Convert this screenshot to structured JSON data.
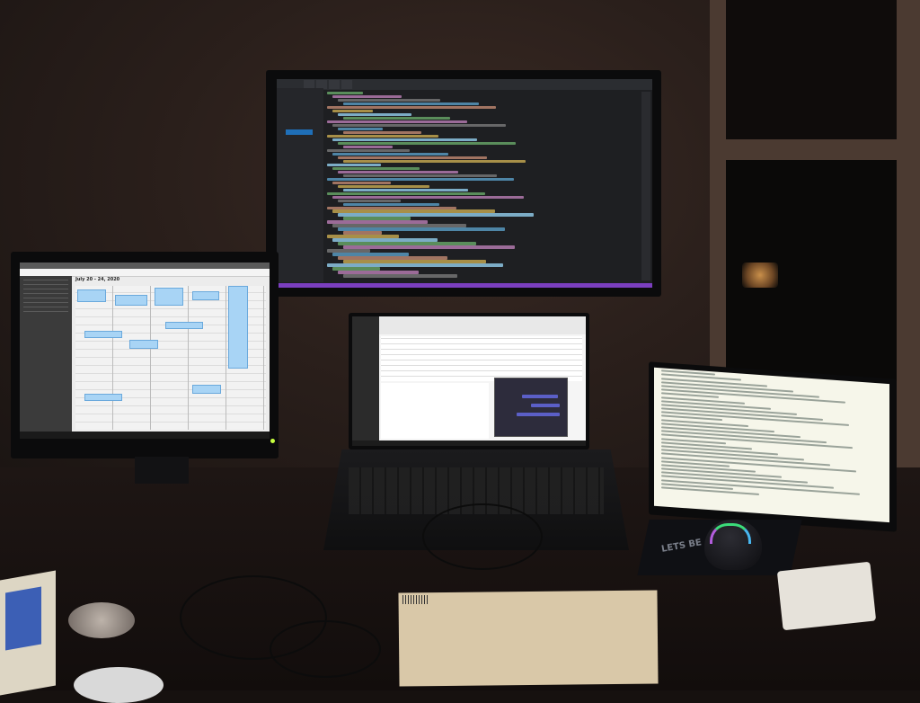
{
  "scene": {
    "description_tag": "desk-workstation-night"
  },
  "top_monitor": {
    "app": "code-editor",
    "tabs": [
      "",
      "",
      "",
      ""
    ],
    "accent": "#7b3fbf"
  },
  "left_monitor": {
    "app": "calendar",
    "heading": "July 20 - 24, 2020"
  },
  "mid_laptop": {
    "app": "email-and-chat"
  },
  "right_laptop": {
    "app": "text-editor"
  },
  "mousepad": {
    "text": "LETS BE"
  },
  "colors": {
    "wall": "#2a1f1b",
    "editor_bg": "#1e1f22",
    "calendar_event": "#a8d4f5",
    "envelope": "#d9c8a8",
    "mouse_led_green": "#3bdc7a"
  }
}
